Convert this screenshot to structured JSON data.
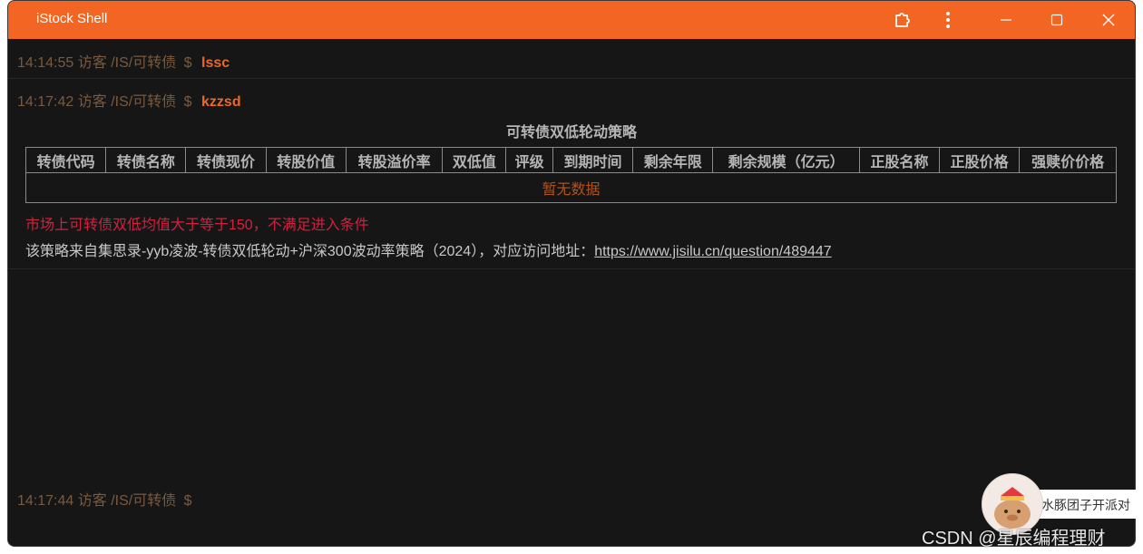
{
  "window": {
    "title": "iStock Shell",
    "accent_color": "#f26522",
    "controls": [
      "puzzle-icon",
      "more-vertical-icon",
      "minimize-icon",
      "maximize-icon",
      "close-icon"
    ]
  },
  "history": [
    {
      "time": "14:14:55",
      "user": "访客",
      "path": "/IS/可转债",
      "prompt": "$",
      "command": "lssc"
    },
    {
      "time": "14:17:42",
      "user": "访客",
      "path": "/IS/可转债",
      "prompt": "$",
      "command": "kzzsd"
    }
  ],
  "strategy": {
    "title": "可转债双低轮动策略",
    "columns": [
      "转债代码",
      "转债名称",
      "转债现价",
      "转股价值",
      "转股溢价率",
      "双低值",
      "评级",
      "到期时间",
      "剩余年限",
      "剩余规模（亿元）",
      "正股名称",
      "正股价格",
      "强赎价价格"
    ],
    "empty_text": "暂无数据",
    "warning": "市场上可转债双低均值大于等于150，不满足进入条件",
    "source_text": "该策略来自集思录-yyb凌波-转债双低轮动+沪深300波动率策略（2024），对应访问地址：",
    "source_link": "https://www.jisilu.cn/question/489447"
  },
  "input_line": {
    "time": "14:17:44",
    "user": "访客",
    "path": "/IS/可转债",
    "prompt": "$"
  },
  "overlay": {
    "bubble_text": "水豚团子开派对",
    "watermark": "CSDN @星辰编程理财"
  }
}
